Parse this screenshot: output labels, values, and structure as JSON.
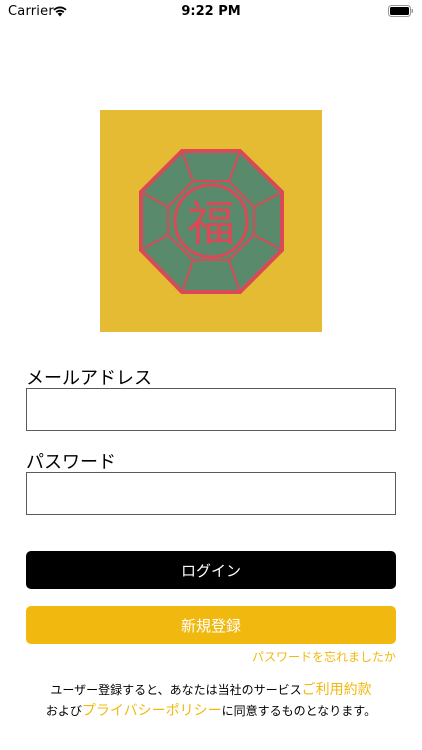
{
  "status_bar": {
    "carrier": "Carrier",
    "time": "9:22 PM",
    "wifi_icon": "wifi-icon",
    "battery_icon": "battery-icon"
  },
  "logo": {
    "icon": "fortune-octagon-logo",
    "glyph": "福",
    "colors": {
      "background": "#e4bb32",
      "octagon_fill": "#5a8a6c",
      "octagon_stroke": "#d94a57"
    }
  },
  "form": {
    "email_label": "メールアドレス",
    "email_value": "",
    "password_label": "パスワード",
    "password_value": ""
  },
  "buttons": {
    "login": "ログイン",
    "register": "新規登録"
  },
  "links": {
    "forgot_password": "パスワードを忘れましたか"
  },
  "terms": {
    "line1_text": "ユーザー登録すると、あなたは当社のサービス",
    "terms_link": "ご利用約款",
    "line2_prefix": "および",
    "privacy_link": "プライバシーポリシー",
    "line2_suffix": "に同意するものとなります。"
  },
  "colors": {
    "accent": "#f1b90f",
    "login_button": "#000000",
    "input_border": "#5a5a5a"
  }
}
